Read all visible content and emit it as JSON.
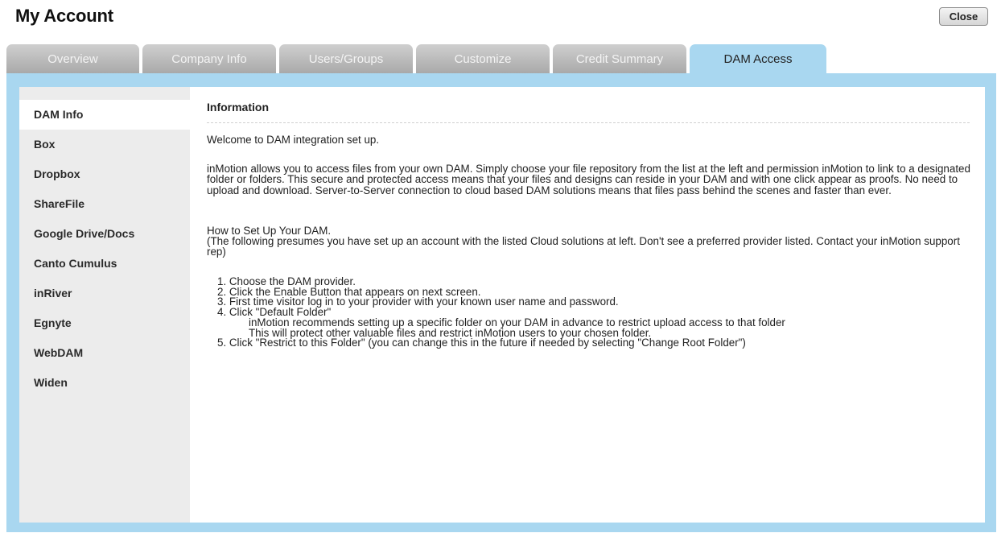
{
  "header": {
    "title": "My Account",
    "close_label": "Close"
  },
  "tabs": [
    {
      "label": "Overview",
      "active": false
    },
    {
      "label": "Company Info",
      "active": false
    },
    {
      "label": "Users/Groups",
      "active": false
    },
    {
      "label": "Customize",
      "active": false
    },
    {
      "label": "Credit Summary",
      "active": false
    },
    {
      "label": "DAM Access",
      "active": true
    }
  ],
  "sidebar": {
    "items": [
      {
        "label": "DAM Info",
        "active": true
      },
      {
        "label": "Box",
        "active": false
      },
      {
        "label": "Dropbox",
        "active": false
      },
      {
        "label": "ShareFile",
        "active": false
      },
      {
        "label": "Google Drive/Docs",
        "active": false
      },
      {
        "label": "Canto Cumulus",
        "active": false
      },
      {
        "label": "inRiver",
        "active": false
      },
      {
        "label": "Egnyte",
        "active": false
      },
      {
        "label": "WebDAM",
        "active": false
      },
      {
        "label": "Widen",
        "active": false
      }
    ]
  },
  "content": {
    "heading": "Information",
    "welcome": "Welcome to DAM integration set up.",
    "intro": "inMotion allows you to access files from your own DAM. Simply choose your file repository from the list at the left and permission inMotion to link to a designated folder or folders. This secure and protected access means that your files and designs can reside in your DAM and with one click appear as proofs. No need to upload and download. Server-to-Server connection to cloud based DAM solutions means that files pass behind the scenes and faster than ever.",
    "howto_title": "How to Set Up Your DAM.",
    "presume": "(The following presumes you have set up an account with the listed Cloud solutions at left. Don't see a preferred provider listed. Contact your inMotion support rep)",
    "steps": [
      "1. Choose the DAM provider.",
      "2. Click the Enable Button that appears on next screen.",
      "3. First time visitor log in to your provider with your known user name and password.",
      "4. Click \"Default Folder\"",
      "inMotion recommends setting up a specific folder on your DAM in advance to restrict upload access to that folder",
      "This will protect other valuable files and restrict inMotion users to your chosen folder.",
      "5. Click \"Restrict to this Folder\" (you can change this in the future if needed by selecting \"Change Root Folder\")"
    ]
  },
  "colors": {
    "frame_blue": "#a9d7f0",
    "tab_inactive": "#a9a9a9",
    "sidebar_bg": "#ececec"
  }
}
